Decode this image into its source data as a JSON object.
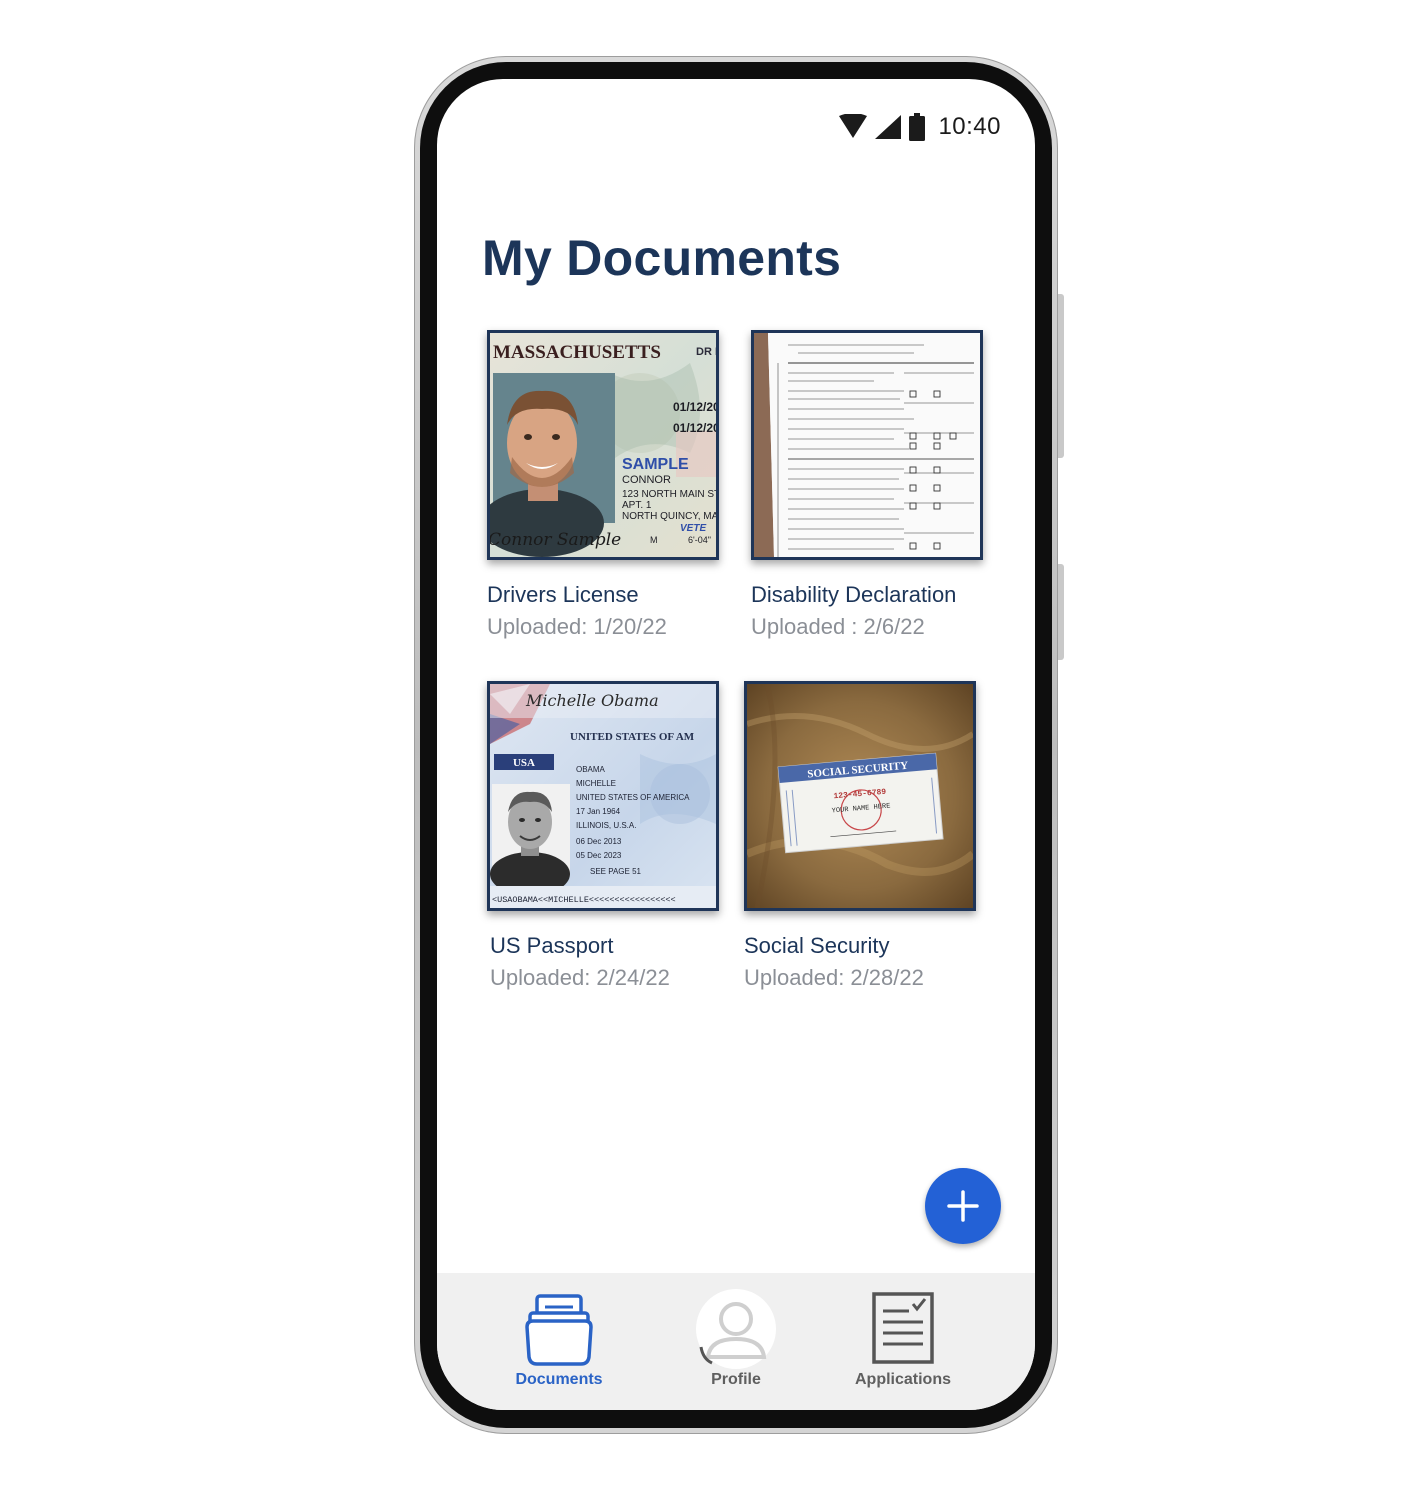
{
  "status_bar": {
    "time": "10:40",
    "icons": [
      "wifi-icon",
      "cell-signal-icon",
      "battery-icon"
    ]
  },
  "page": {
    "title": "My Documents"
  },
  "documents": [
    {
      "title": "Drivers License",
      "uploaded": "Uploaded: 1/20/22",
      "thumbnail": "drivers-license-image"
    },
    {
      "title": "Disability Declaration",
      "uploaded": "Uploaded : 2/6/22",
      "thumbnail": "disability-form-image"
    },
    {
      "title": "US Passport",
      "uploaded": "Uploaded: 2/24/22",
      "thumbnail": "passport-image"
    },
    {
      "title": "Social Security",
      "uploaded": "Uploaded: 2/28/22",
      "thumbnail": "social-security-card-image"
    }
  ],
  "fab": {
    "icon": "plus-icon"
  },
  "bottom_nav": {
    "items": [
      {
        "label": "Documents",
        "icon": "documents-folder-icon",
        "active": true
      },
      {
        "label": "Profile",
        "icon": "profile-avatar-icon",
        "active": false
      },
      {
        "label": "Applications",
        "icon": "applications-checklist-icon",
        "active": false
      }
    ]
  },
  "colors": {
    "title": "#1c3559",
    "subtitle": "#8b8f96",
    "accent": "#2361d6",
    "nav_active": "#2a63c6",
    "nav_inactive": "#5f5f5f",
    "nav_background": "#f0f0f0"
  },
  "thumbnail_text": {
    "license": {
      "state": "MASSACHUSETTS",
      "corner": "DR LIC",
      "iss": "01/12/20",
      "exp": "01/12/20",
      "sample": "SAMPLE",
      "first": "CONNOR",
      "address1": "123 NORTH MAIN ST",
      "address2": "APT. 1",
      "address3": "NORTH QUINCY, MA",
      "sex": "M",
      "height": "6'-04\"",
      "veteran": "VETE",
      "signature": "Connor Sample"
    },
    "passport": {
      "signature": "Michelle Obama",
      "country": "UNITED STATES OF AM",
      "usa": "USA",
      "surname": "OBAMA",
      "given": "MICHELLE",
      "nationality": "UNITED STATES OF AMERICA",
      "dob": "17 Jan 1964",
      "pob": "ILLINOIS, U.S.A.",
      "issued": "06 Dec 2013",
      "expires": "05 Dec 2023",
      "endorsement": "SEE PAGE 51",
      "mrz": "<USAOBAMA<<MICHELLE<<<<<<<<<<<<<<<<<"
    },
    "social_security": {
      "heading": "SOCIAL SECURITY",
      "number": "123-45-6789",
      "name": "YOUR NAME HERE"
    }
  }
}
